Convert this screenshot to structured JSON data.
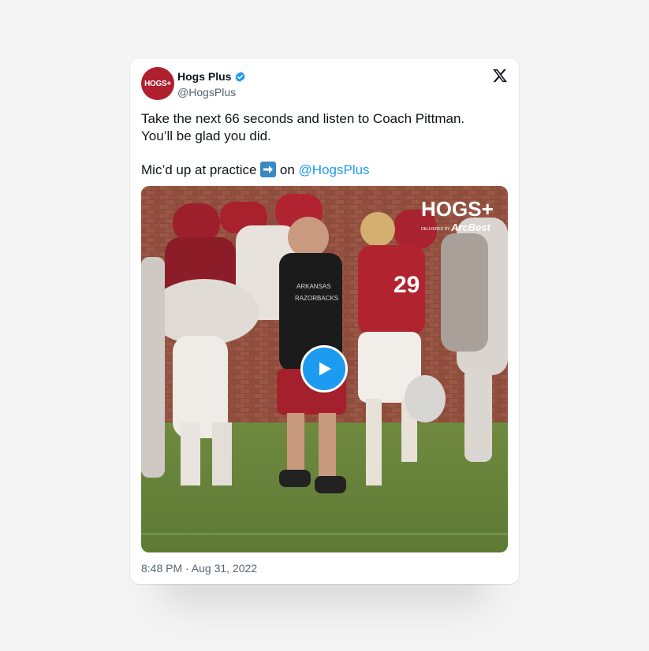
{
  "tweet": {
    "author_name": "Hogs Plus",
    "handle": "@HogsPlus",
    "avatar_text": "HOGS+",
    "text_line1": "Take the next 66 seconds and listen to Coach Pittman.",
    "text_line2": "You’ll be glad you did.",
    "text_line3_prefix": "Mic’d up at practice ",
    "text_line3_on": " on ",
    "mention": "@HogsPlus",
    "timestamp": "8:48 PM · Aug 31, 2022"
  },
  "media": {
    "watermark_brand": "HOGS+",
    "watermark_sub": "DELIVERED BY",
    "watermark_sponsor": "ArcBest",
    "jersey_number": "29",
    "shirt_text_1": "ARKANSAS",
    "shirt_text_2": "RAZORBACKS"
  },
  "colors": {
    "accent": "#1d9bf0",
    "brand_red": "#b01f2e",
    "text_primary": "#0f1419",
    "text_secondary": "#536471"
  },
  "icons": {
    "verified": "verified-badge-icon",
    "platform": "x-logo-icon",
    "play": "play-icon",
    "arrow": "right-arrow-emoji-icon"
  }
}
